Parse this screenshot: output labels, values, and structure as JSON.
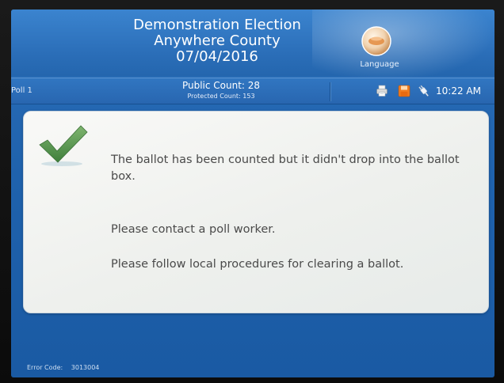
{
  "header": {
    "title_line1": "Demonstration Election",
    "title_line2": "Anywhere County",
    "title_line3": "07/04/2016",
    "language_label": "Language"
  },
  "statusbar": {
    "poll": "Poll 1",
    "public_count": "Public Count: 28",
    "protected_count": "Protected Count: 153",
    "time": "10:22 AM",
    "icons": [
      "printer-icon",
      "save-icon",
      "power-plug-icon"
    ]
  },
  "message": {
    "icon": "checkmark-icon",
    "main": "The ballot has been counted but it didn't drop into the ballot box.",
    "contact": "Please contact a poll worker.",
    "procedure": "Please follow local procedures for clearing a ballot."
  },
  "footer": {
    "error_label": "Error Code:",
    "error_value": "3013004"
  },
  "colors": {
    "screen_blue": "#1f62ad",
    "panel_bg": "#f1f2ef",
    "check_green": "#5a9a55",
    "text_gray": "#4a4a4a"
  }
}
